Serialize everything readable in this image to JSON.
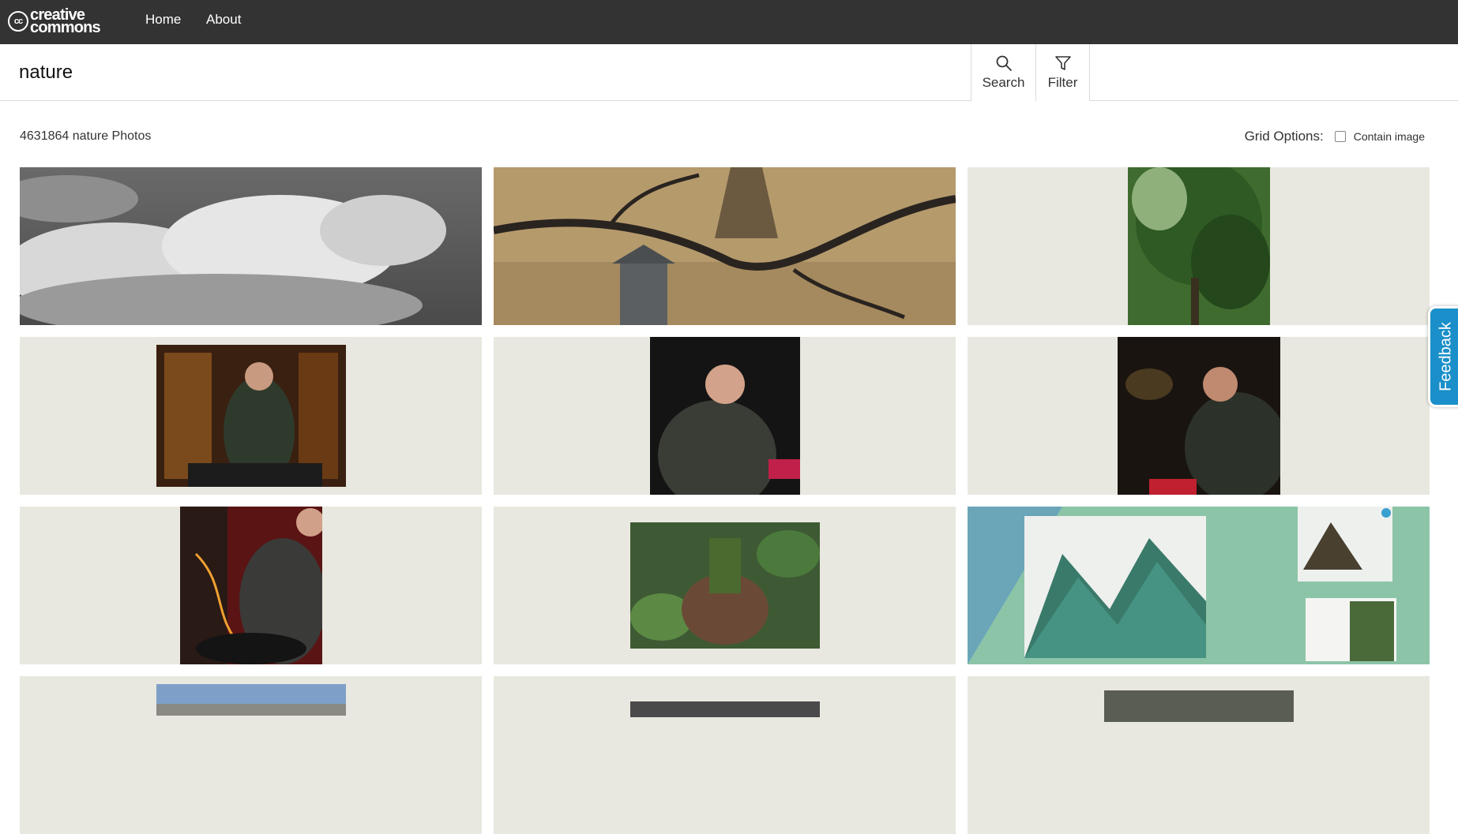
{
  "header": {
    "logo_line1": "creative",
    "logo_line2": "commons",
    "logo_cc": "cc",
    "nav": [
      "Home",
      "About"
    ]
  },
  "search": {
    "value": "nature",
    "search_label": "Search",
    "filter_label": "Filter"
  },
  "results": {
    "count_text": "4631864 nature Photos",
    "grid_options_label": "Grid Options:",
    "contain_image_label": "Contain image",
    "contain_image_checked": false
  },
  "feedback_label": "Feedback",
  "icons": {
    "search": "search-icon",
    "filter": "filter-icon"
  },
  "colors": {
    "topbar": "#333333",
    "cell_bg": "#e8e8e0",
    "feedback": "#1a8fc9"
  },
  "images": [
    {
      "subject": "clouds"
    },
    {
      "subject": "branches-lantern"
    },
    {
      "subject": "trees"
    },
    {
      "subject": "dj-1"
    },
    {
      "subject": "dj-2"
    },
    {
      "subject": "dj-3"
    },
    {
      "subject": "dj-4"
    },
    {
      "subject": "palm-ivy"
    },
    {
      "subject": "magazine"
    },
    {
      "subject": "winter-trees"
    },
    {
      "subject": "bw-photo"
    },
    {
      "subject": "forest"
    }
  ]
}
